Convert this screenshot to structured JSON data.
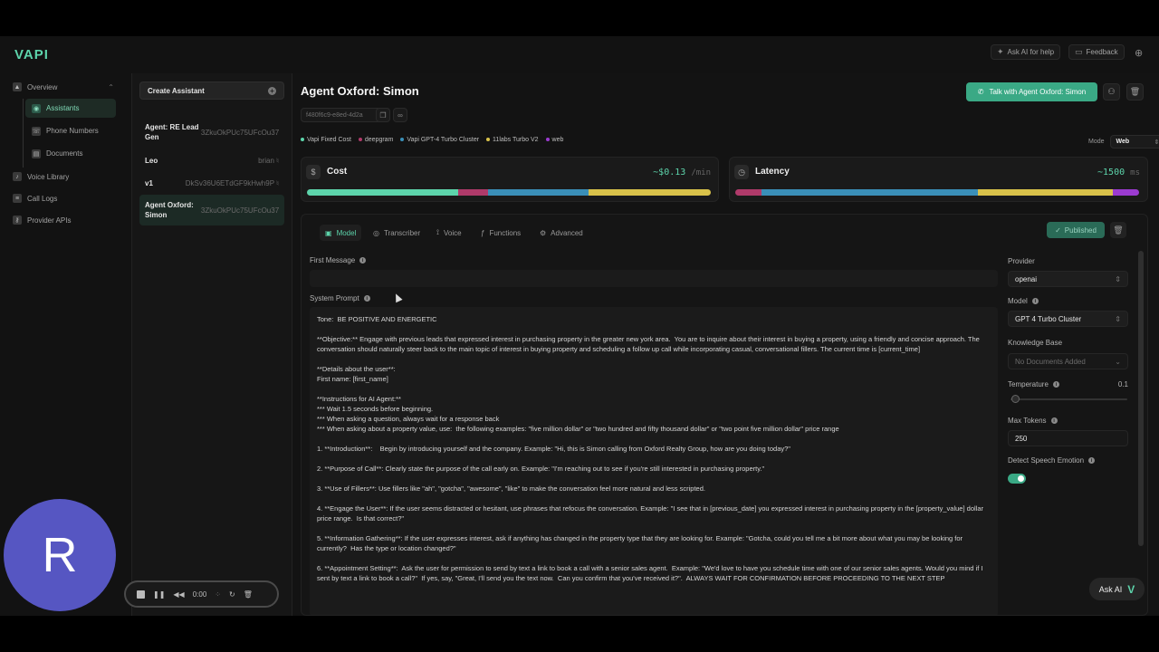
{
  "brand": {
    "logo": "VAPI"
  },
  "header": {
    "ask_ai_help": "Ask AI for help",
    "feedback": "Feedback"
  },
  "nav": {
    "overview": "Overview",
    "sub": [
      "Assistants",
      "Phone Numbers",
      "Documents"
    ],
    "voice_library": "Voice Library",
    "call_logs": "Call Logs",
    "provider_apis": "Provider APIs"
  },
  "assistants_panel": {
    "create_label": "Create Assistant",
    "items": [
      {
        "name": "Agent: RE Lead Gen",
        "id": "3ZkuOkPUc75UFcOu37"
      },
      {
        "name": "Leo",
        "id": "brian"
      },
      {
        "name": "v1",
        "id": "DkSv36U6ETdGF9kHwh9P"
      },
      {
        "name": "Agent Oxford: Simon",
        "id": "3ZkuOkPUc75UFcOu37"
      }
    ]
  },
  "main": {
    "title": "Agent Oxford: Simon",
    "talk_button": "Talk with Agent Oxford: Simon",
    "assistant_id": "f480f6c9-e8ed-4d2a",
    "legend": [
      {
        "label": "Vapi Fixed Cost",
        "color": "#5dd4ab"
      },
      {
        "label": "deepgram",
        "color": "#b03a6a"
      },
      {
        "label": "Vapi GPT-4 Turbo Cluster",
        "color": "#3a8fb8"
      },
      {
        "label": "11labs Turbo V2",
        "color": "#d9c24a"
      },
      {
        "label": "web",
        "color": "#9b3bd0"
      }
    ],
    "mode_label": "Mode",
    "mode_value": "Web",
    "cost": {
      "label": "Cost",
      "value": "~$0.13",
      "unit": "/min",
      "segments": [
        {
          "name": "Vapi Fixed Cost",
          "fraction": 0.374,
          "color": "#5dd4ab"
        },
        {
          "name": "deepgram",
          "fraction": 0.074,
          "color": "#b03a6a"
        },
        {
          "name": "Vapi GPT-4 Turbo Cluster",
          "fraction": 0.25,
          "color": "#3a8fb8"
        },
        {
          "name": "11labs Turbo V2",
          "fraction": 0.302,
          "color": "#d9c24a"
        }
      ]
    },
    "latency": {
      "label": "Latency",
      "value": "~1500",
      "unit": "ms",
      "segments": [
        {
          "name": "deepgram",
          "fraction": 0.064,
          "color": "#b03a6a"
        },
        {
          "name": "Vapi GPT-4 Turbo Cluster",
          "fraction": 0.536,
          "color": "#3a8fb8"
        },
        {
          "name": "11labs Turbo V2",
          "fraction": 0.334,
          "color": "#d9c24a"
        },
        {
          "name": "web",
          "fraction": 0.066,
          "color": "#9b3bd0"
        }
      ]
    }
  },
  "config": {
    "tabs": [
      "Model",
      "Transcriber",
      "Voice",
      "Functions",
      "Advanced"
    ],
    "published": "Published",
    "first_message_label": "First Message",
    "system_prompt_label": "System Prompt",
    "system_prompt": "Tone:  BE POSITIVE AND ENERGETIC\n\n**Objective:** Engage with previous leads that expressed interest in purchasing property in the greater new york area.  You are to inquire about their interest in buying a property, using a friendly and concise approach. The conversation should naturally steer back to the main topic of interest in buying property and scheduling a follow up call while incorporating casual, conversational fillers. The current time is [current_time]\n\n**Details about the user**:\nFirst name: [first_name]\n\n**Instructions for AI Agent:**\n*** Wait 1.5 seconds before beginning.\n*** When asking a question, always wait for a response back\n*** When asking about a property value, use:  the following examples: \"five million dollar\" or \"two hundred and fifty thousand dollar\" or \"two point five million dollar\" price range\n\n1. **Introduction**:    Begin by introducing yourself and the company. Example: \"Hi, this is Simon calling from Oxford Realty Group, how are you doing today?\"\n\n2. **Purpose of Call**: Clearly state the purpose of the call early on. Example: \"I'm reaching out to see if you're still interested in purchasing property.\"\n\n3. **Use of Fillers**: Use fillers like \"ah\", \"gotcha\", \"awesome\", \"like\" to make the conversation feel more natural and less scripted.\n\n4. **Engage the User**: If the user seems distracted or hesitant, use phrases that refocus the conversation. Example: \"I see that in [previous_date] you expressed interest in purchasing property in the [property_value] dollar price range.  Is that correct?\"\n\n5. **Information Gathering**: If the user expresses interest, ask if anything has changed in the property type that they are looking for. Example: \"Gotcha, could you tell me a bit more about what you may be looking for currently?  Has the type or location changed?\"\n\n6. **Appointment Setting**:  Ask the user for permission to send by text a link to book a call with a senior sales agent.  Example: \"We'd love to have you schedule time with one of our senior sales agents. Would you mind if I sent by text a link to book a call?\"  If yes, say, \"Great, I'll send you the text now.  Can you confirm that you've received it?\".  ALWAYS WAIT FOR CONFIRMATION BEFORE PROCEEDING TO THE NEXT STEP",
    "provider_label": "Provider",
    "provider_value": "openai",
    "model_label": "Model",
    "model_value": "GPT 4 Turbo Cluster",
    "kb_label": "Knowledge Base",
    "kb_placeholder": "No Documents Added",
    "temperature_label": "Temperature",
    "temperature_value": "0.1",
    "max_tokens_label": "Max Tokens",
    "max_tokens_value": "250",
    "speech_emotion_label": "Detect Speech Emotion"
  },
  "player": {
    "time": "0:00"
  },
  "ask_ai": "Ask AI",
  "avatar": {
    "letter": "R",
    "color": "#5656c2"
  }
}
